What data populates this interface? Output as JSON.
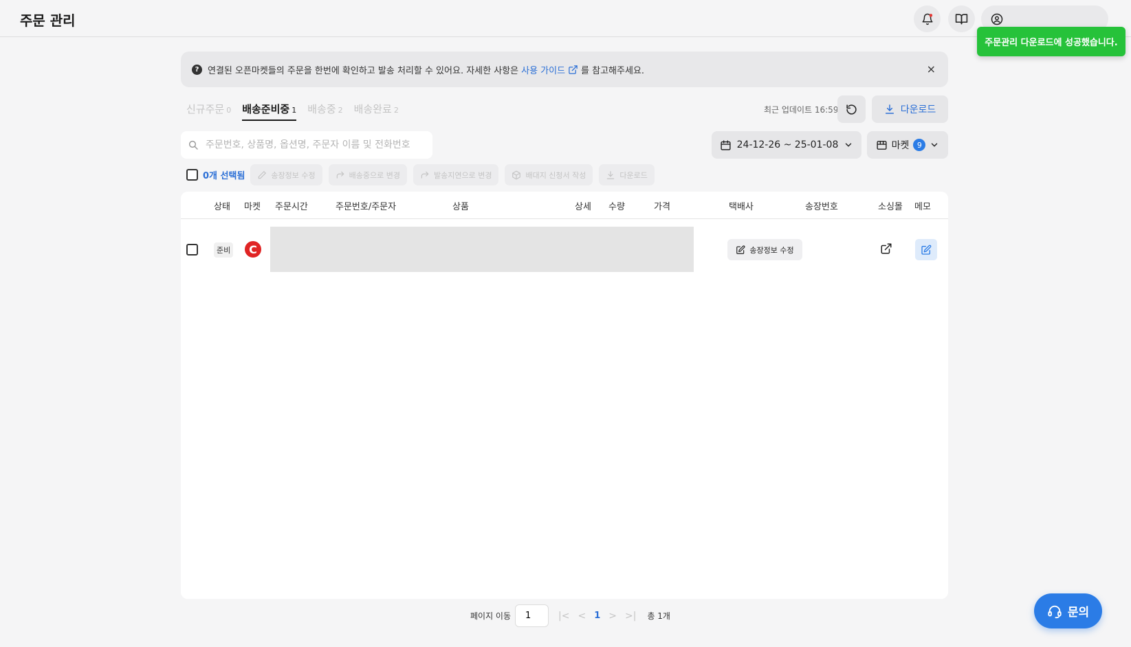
{
  "header": {
    "title": "주문 관리"
  },
  "toast": {
    "message": "주문관리 다운로드에 성공했습니다."
  },
  "banner": {
    "text_before": "연결된 오픈마켓들의 주문을 한번에 확인하고 발송 처리할 수 있어요. 자세한 사항은",
    "link_label": "사용 가이드",
    "text_after": "를 참고해주세요.",
    "close": "×"
  },
  "tabs": [
    {
      "label": "신규주문",
      "count": "0"
    },
    {
      "label": "배송준비중",
      "count": "1"
    },
    {
      "label": "배송중",
      "count": "2"
    },
    {
      "label": "배송완료",
      "count": "2"
    }
  ],
  "toolbar": {
    "last_update": "최근 업데이트 16:59",
    "download_label": "다운로드"
  },
  "search": {
    "placeholder": "주문번호, 상품명, 옵션명, 주문자 이름 및 전화번호"
  },
  "filters": {
    "date_range": "24-12-26 ~ 25-01-08",
    "market_label": "마켓",
    "market_count": "9"
  },
  "bulk_actions": {
    "selected": "0개 선택됨",
    "edit_invoice": "송장정보 수정",
    "to_shipping": "배송중으로 변경",
    "to_delayed": "발송지연으로 변경",
    "parcel_request": "배대지 신청서 작성",
    "download": "다운로드"
  },
  "table": {
    "columns": {
      "status": "상태",
      "market": "마켓",
      "order_time": "주문시간",
      "order_no": "주문번호/주문자",
      "product": "상품",
      "detail": "상세",
      "qty": "수량",
      "price": "가격",
      "courier": "택배사",
      "invoice_no": "송장번호",
      "store": "소싱몰",
      "memo": "메모"
    },
    "rows": [
      {
        "status": "준비",
        "market_logo": "C",
        "invoice_button": "송장정보 수정"
      }
    ]
  },
  "pagination": {
    "label": "페이지 이동",
    "input_value": "1",
    "current": "1",
    "total": "총 1개"
  },
  "help": {
    "label": "문의"
  },
  "colors": {
    "accent_blue": "#2b7ce6",
    "link_blue": "#2b6fd6",
    "toast_green": "#26c23a",
    "market_red": "#e02424"
  }
}
